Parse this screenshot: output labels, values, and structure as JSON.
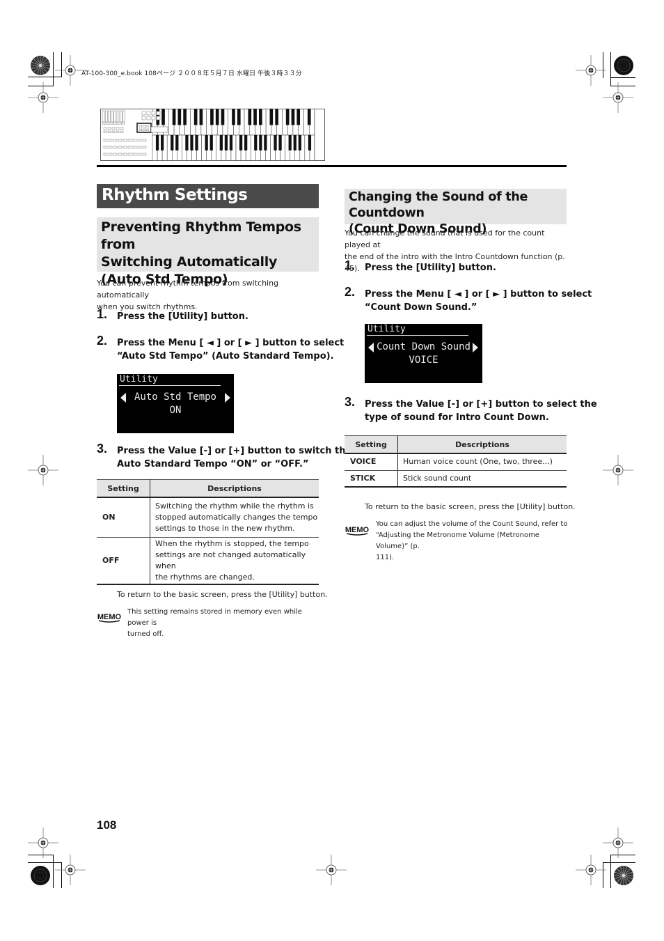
{
  "print_header": "AT-100-300_e.book  108ページ  ２００８年５月７日  水曜日  午後３時３３分",
  "page_title": "Rhythm Settings",
  "page_number": "108",
  "left_section": {
    "heading_lines": [
      "Preventing Rhythm Tempos from",
      "Switching Automatically",
      "(Auto Std Tempo)"
    ],
    "intro_lines": [
      "You can prevent rhythm tempos from switching automatically",
      "when you switch rhythms."
    ],
    "steps": [
      {
        "num": "1.",
        "lines": [
          "Press the [Utility] button."
        ]
      },
      {
        "num": "2.",
        "lines": [
          "Press the Menu [ ◄ ] or [ ► ] button to select",
          "“Auto Std Tempo” (Auto Standard Tempo)."
        ]
      },
      {
        "num": "3.",
        "lines": [
          "Press the Value [-] or [+] button to switch the",
          "Auto Standard Tempo “ON” or “OFF.”"
        ]
      }
    ],
    "display": {
      "title": "Utility",
      "parameter": "Auto Std Tempo",
      "value": "ON"
    },
    "table": {
      "headers": [
        "Setting",
        "Descriptions"
      ],
      "rows": [
        {
          "setting": "ON",
          "lines": [
            "Switching the rhythm while the rhythm is",
            "stopped automatically changes the tempo",
            "settings to those in the new rhythm."
          ]
        },
        {
          "setting": "OFF",
          "lines": [
            "When the rhythm is stopped, the tempo",
            "settings are not changed automatically when",
            "the rhythms are changed."
          ]
        }
      ]
    },
    "return_note": "To return to the basic screen, press the [Utility] button.",
    "memo": {
      "icon_label": "MEMO",
      "lines": [
        "This setting remains stored in memory even while power is",
        "turned off."
      ]
    }
  },
  "right_section": {
    "heading_lines": [
      "Changing the Sound of the Countdown",
      "(Count Down Sound)"
    ],
    "intro_lines": [
      "You can change the sound that is used for the count played at",
      "the end of the intro with the Intro Countdown function (p. 45)."
    ],
    "steps": [
      {
        "num": "1.",
        "lines": [
          "Press the [Utility] button."
        ]
      },
      {
        "num": "2.",
        "lines": [
          "Press the Menu [ ◄ ] or [ ► ] button to select",
          "“Count Down Sound.”"
        ]
      },
      {
        "num": "3.",
        "lines": [
          "Press the Value [-] or [+] button to select the",
          "type of sound for Intro Count Down."
        ]
      }
    ],
    "display": {
      "title": "Utility",
      "parameter": "Count Down Sound",
      "value": "VOICE"
    },
    "table": {
      "headers": [
        "Setting",
        "Descriptions"
      ],
      "rows": [
        {
          "setting": "VOICE",
          "lines": [
            "Human voice count (One, two, three...)"
          ]
        },
        {
          "setting": "STICK",
          "lines": [
            "Stick sound count"
          ]
        }
      ]
    },
    "return_note": "To return to the basic screen, press the [Utility] button.",
    "memo": {
      "icon_label": "MEMO",
      "lines": [
        "You can adjust the volume of the Count Sound, refer to",
        "“Adjusting the Metronome Volume (Metronome Volume)” (p.",
        "111)."
      ]
    }
  },
  "icons": {
    "registration_mark": "crosshair-target",
    "color_bar": "radial-disc",
    "keyboard_illustration": "organ-panel-highlighted-utility",
    "memo": "memo-badge"
  }
}
